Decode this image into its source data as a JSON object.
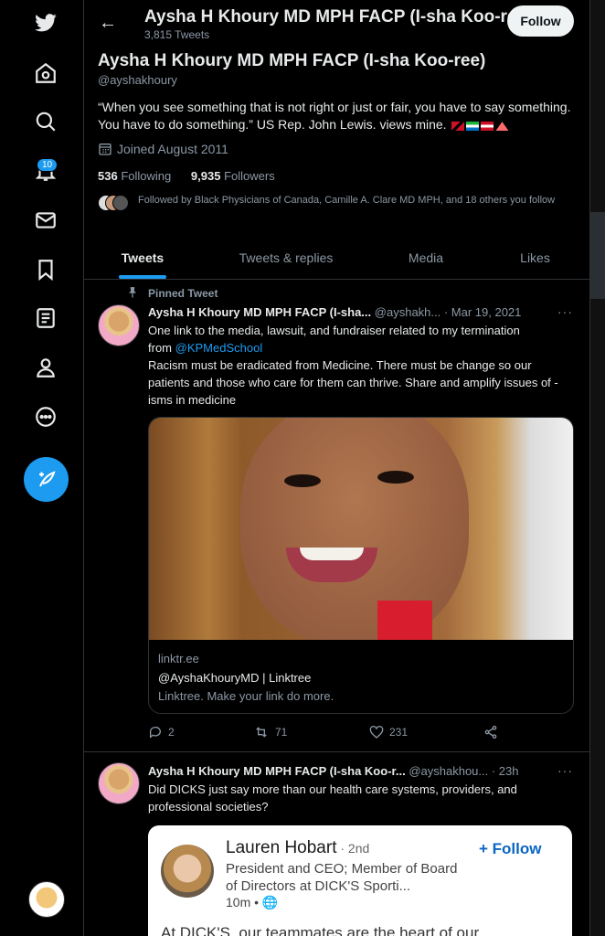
{
  "profile": {
    "top_name": "Aysha H Khoury MD MPH FACP (I-sha Koo-ree)",
    "tweet_count": "3,815 Tweets",
    "follow_label": "Follow",
    "name": "Aysha H Khoury MD MPH FACP (I-sha Koo-ree)",
    "handle": "@ayshakhoury",
    "bio": "“When you see something that is not right or just or fair, you have to say something. You have to do something.” US Rep. John Lewis. views mine.",
    "joined": "Joined August 2011",
    "following_count": "536",
    "following_label": "Following",
    "followers_count": "9,935",
    "followers_label": "Followers",
    "followed_by": "Followed by Black Physicians of Canada, Camille A. Clare MD MPH, and 18 others you follow"
  },
  "nav": {
    "notifications_badge": "10"
  },
  "tabs": [
    "Tweets",
    "Tweets & replies",
    "Media",
    "Likes"
  ],
  "tweet1": {
    "pinned_label": "Pinned Tweet",
    "name": "Aysha H Khoury MD MPH FACP (I-sha...",
    "handle_time": "@ayshakh... · Mar 19, 2021",
    "text_line1": "One link to the media, lawsuit, and fundraiser related to my termination",
    "text_from": "from ",
    "mention": "@KPMedSchool",
    "text_rest": "Racism must be eradicated from Medicine. There must be change so our patients and those who care for them can thrive. Share and amplify issues of -isms in medicine",
    "card_domain": "linktr.ee",
    "card_title": "@AyshaKhouryMD | Linktree",
    "card_desc": "Linktree. Make your link do more.",
    "replies": "2",
    "retweets": "71",
    "likes": "231"
  },
  "tweet2": {
    "name": "Aysha H Khoury MD MPH FACP (I-sha Koo-r...",
    "handle_time": "@ayshakhou... · 23h",
    "text": "Did DICKS just say more than our health care systems, providers, and professional societies?",
    "li_name": "Lauren Hobart",
    "li_degree": " · 2nd",
    "li_title": "President and CEO; Member of Board of Directors at DICK'S Sporti...",
    "li_time": "10m •",
    "li_follow": "+ Follow",
    "li_body": "At DICK'S, our teammates are the heart of our"
  },
  "colors": {
    "accent": "#1d9bf0",
    "background": "#000000",
    "muted_text": "#8b98a5",
    "linkedin_blue": "#0a66c2"
  },
  "icons": [
    "twitter-logo-icon",
    "home-icon",
    "explore-icon",
    "notifications-icon",
    "messages-icon",
    "bookmarks-icon",
    "lists-icon",
    "profile-icon",
    "more-icon",
    "compose-icon",
    "back-arrow-icon",
    "calendar-icon",
    "pin-icon",
    "reply-icon",
    "retweet-icon",
    "like-icon",
    "share-icon",
    "globe-icon"
  ]
}
